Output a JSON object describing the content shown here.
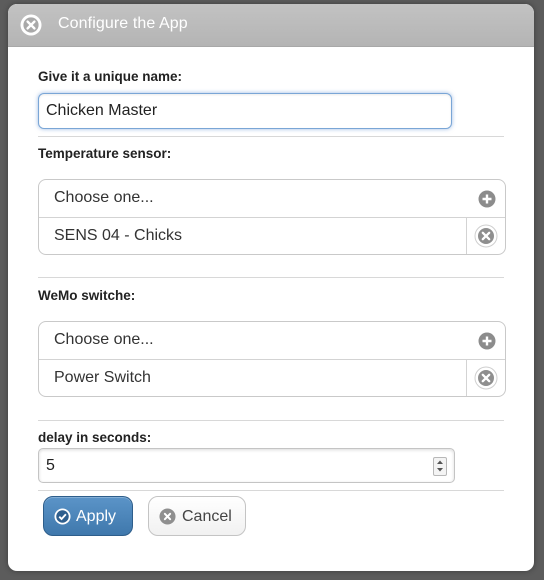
{
  "dialog": {
    "title": "Configure the App",
    "close_icon": "close-circle-icon"
  },
  "name_section": {
    "label": "Give it a unique name:",
    "value": "Chicken Master"
  },
  "temperature_section": {
    "label": "Temperature sensor:",
    "choose_label": "Choose one...",
    "selected": "SENS 04 - Chicks"
  },
  "wemo_section": {
    "label": "WeMo switche:",
    "choose_label": "Choose one...",
    "selected": "Power Switch"
  },
  "delay_section": {
    "label": "delay in seconds:",
    "value": "5"
  },
  "buttons": {
    "apply_label": "Apply",
    "cancel_label": "Cancel"
  },
  "icons": {
    "add": "plus-circle-icon",
    "remove": "x-circle-icon",
    "apply": "check-circle-icon",
    "cancel": "x-circle-icon"
  },
  "colors": {
    "primary": "#4a84b9",
    "title_bar": "#bcbcbc",
    "backdrop": "#5c5c5c"
  }
}
